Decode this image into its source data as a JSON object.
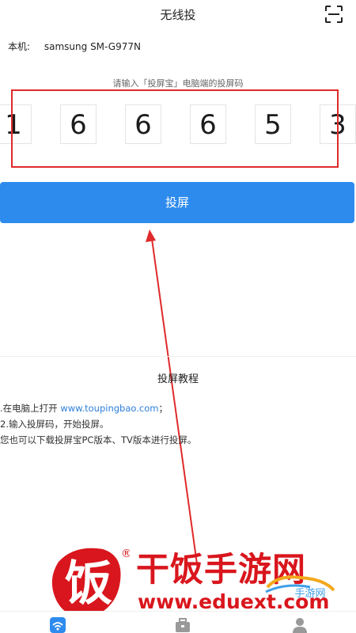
{
  "header": {
    "title": "无线投",
    "scan_icon": "scan-icon"
  },
  "device": {
    "label": "本机:",
    "name": "samsung SM-G977N"
  },
  "code_prompt": "请输入「投屏宝」电脑端的投屏码",
  "code_digits": [
    "1",
    "6",
    "6",
    "6",
    "5",
    "3"
  ],
  "cast_button_label": "投屏",
  "tutorial": {
    "title": "投屏教程",
    "step1_prefix": ".在电脑上打开 ",
    "step1_link": "www.toupingbao.com",
    "step1_suffix": "；",
    "step2": "2.输入投屏码，开始投屏。",
    "step3": "您也可以下载投屏宝PC版本、TV版本进行投屏。"
  },
  "watermark": {
    "logo_char": "饭",
    "registered": "®",
    "name": "干饭手游网",
    "url": "www.eduext.com",
    "badge_text": "手游网"
  },
  "tabbar": {
    "items": [
      {
        "icon": "wireless-cast-icon",
        "active": true
      },
      {
        "icon": "toolbox-icon",
        "active": false
      },
      {
        "icon": "user-icon",
        "active": false
      }
    ]
  },
  "colors": {
    "accent": "#2e8bee",
    "annotation_red": "#e02a2a",
    "watermark_red": "#d9161d",
    "link": "#2e7fd8"
  }
}
